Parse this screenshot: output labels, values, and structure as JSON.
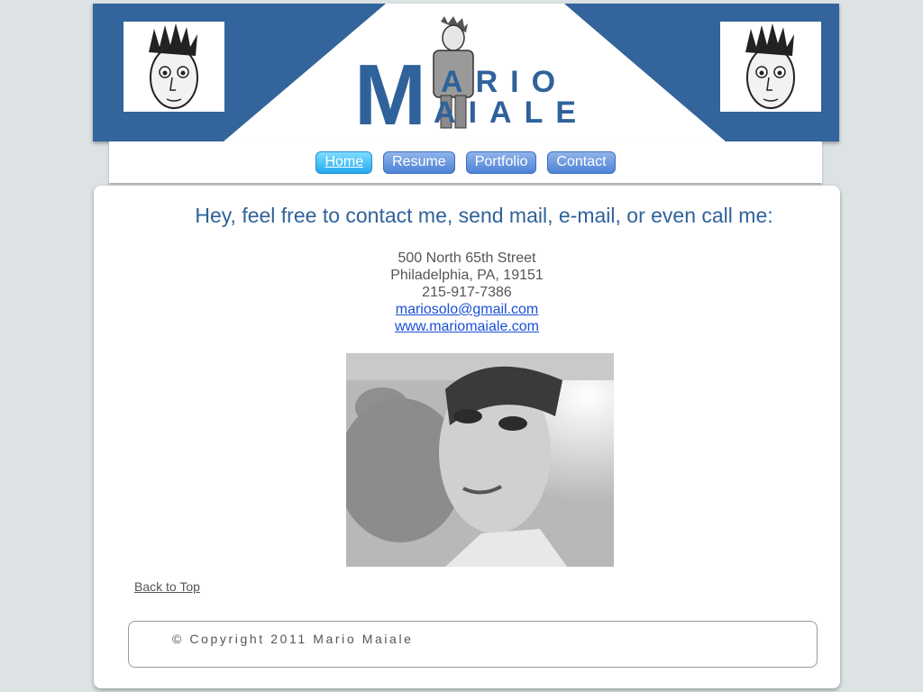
{
  "header": {
    "logo_letter": "M",
    "name_first_rest": "RIO",
    "name_second_rest": "IALE",
    "name_first_a": "A",
    "name_second_a": "A"
  },
  "nav": {
    "items": [
      {
        "label": "Home",
        "active": true
      },
      {
        "label": "Resume",
        "active": false
      },
      {
        "label": "Portfolio",
        "active": false
      },
      {
        "label": "Contact",
        "active": false
      }
    ]
  },
  "contact": {
    "headline": "Hey, feel free to contact me, send mail, e-mail, or even call me:",
    "street": "500 North 65th Street",
    "city": "Philadelphia, PA, 19151",
    "phone": "215-917-7386",
    "email": "mariosolo@gmail.com",
    "website": "www.mariomaiale.com"
  },
  "back_to_top": "Back to Top",
  "footer": {
    "copyright": "© Copyright 2011 Mario Maiale"
  },
  "colors": {
    "brand_blue": "#2f629a",
    "page_bg": "#dde3e5",
    "link": "#1a4fd6"
  }
}
